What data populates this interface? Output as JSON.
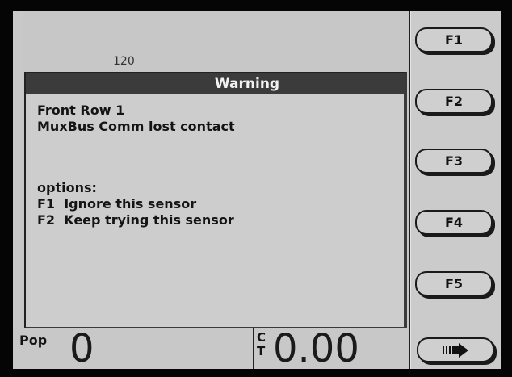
{
  "background": {
    "value": "120"
  },
  "dialog": {
    "title": "Warning",
    "line1": "Front Row 1",
    "line2": "MuxBus Comm lost contact",
    "options_label": "options:",
    "option1": "F1  Ignore this sensor",
    "option2": "F2  Keep trying this sensor"
  },
  "softkeys": [
    "F1",
    "F2",
    "F3",
    "F4",
    "F5"
  ],
  "status": {
    "pop_label": "Pop",
    "pop_value": "0",
    "ct_label_top": "C",
    "ct_label_bottom": "T",
    "ct_value": "0.00"
  },
  "icons": {
    "next_page": "arrow-right-icon"
  }
}
